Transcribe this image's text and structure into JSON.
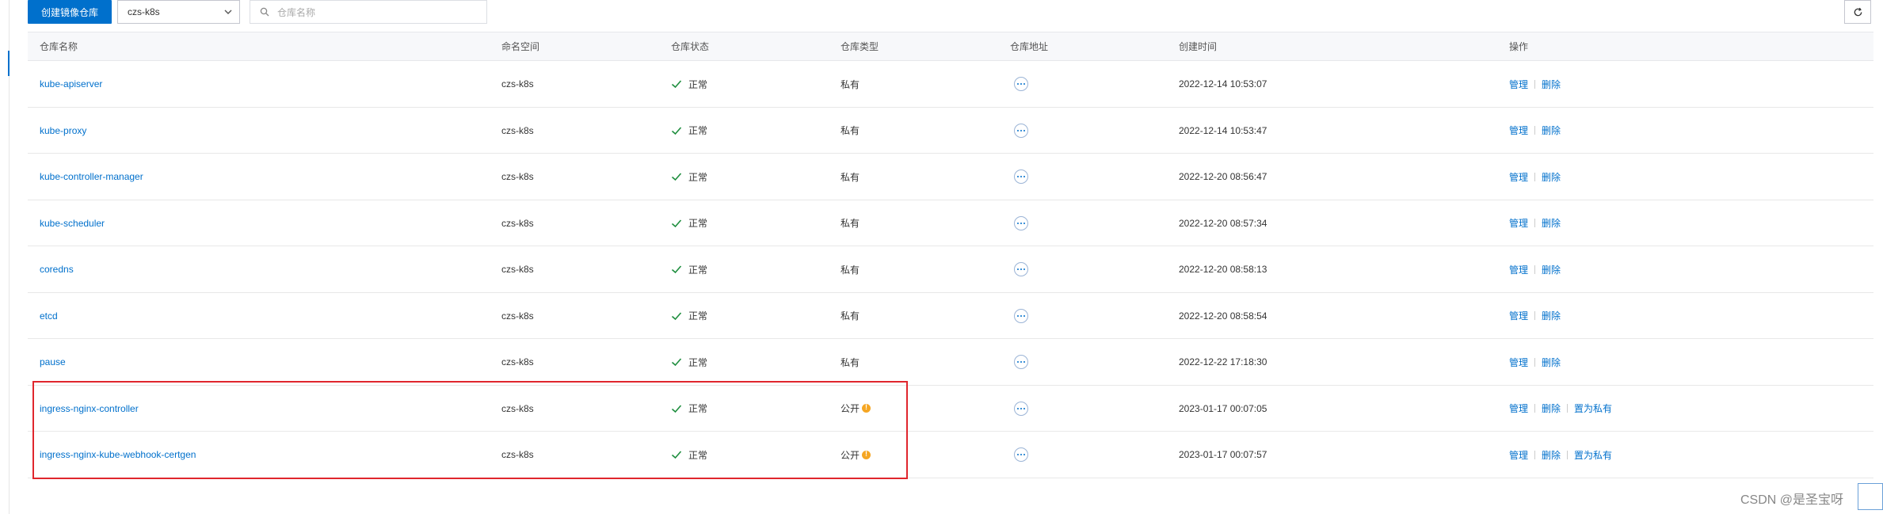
{
  "toolbar": {
    "create_label": "创建镜像仓库",
    "namespace_value": "czs-k8s",
    "search_placeholder": "仓库名称"
  },
  "columns": [
    "仓库名称",
    "命名空间",
    "仓库状态",
    "仓库类型",
    "仓库地址",
    "创建时间",
    "操作"
  ],
  "rows": [
    {
      "name": "kube-apiserver",
      "namespace": "czs-k8s",
      "status": "正常",
      "type": "私有",
      "created": "2022-12-14 10:53:07",
      "ops": [
        "管理",
        "删除"
      ]
    },
    {
      "name": "kube-proxy",
      "namespace": "czs-k8s",
      "status": "正常",
      "type": "私有",
      "created": "2022-12-14 10:53:47",
      "ops": [
        "管理",
        "删除"
      ]
    },
    {
      "name": "kube-controller-manager",
      "namespace": "czs-k8s",
      "status": "正常",
      "type": "私有",
      "created": "2022-12-20 08:56:47",
      "ops": [
        "管理",
        "删除"
      ]
    },
    {
      "name": "kube-scheduler",
      "namespace": "czs-k8s",
      "status": "正常",
      "type": "私有",
      "created": "2022-12-20 08:57:34",
      "ops": [
        "管理",
        "删除"
      ]
    },
    {
      "name": "coredns",
      "namespace": "czs-k8s",
      "status": "正常",
      "type": "私有",
      "created": "2022-12-20 08:58:13",
      "ops": [
        "管理",
        "删除"
      ]
    },
    {
      "name": "etcd",
      "namespace": "czs-k8s",
      "status": "正常",
      "type": "私有",
      "created": "2022-12-20 08:58:54",
      "ops": [
        "管理",
        "删除"
      ]
    },
    {
      "name": "pause",
      "namespace": "czs-k8s",
      "status": "正常",
      "type": "私有",
      "created": "2022-12-22 17:18:30",
      "ops": [
        "管理",
        "删除"
      ]
    },
    {
      "name": "ingress-nginx-controller",
      "namespace": "czs-k8s",
      "status": "正常",
      "type": "公开",
      "created": "2023-01-17 00:07:05",
      "ops": [
        "管理",
        "删除",
        "置为私有"
      ]
    },
    {
      "name": "ingress-nginx-kube-webhook-certgen",
      "namespace": "czs-k8s",
      "status": "正常",
      "type": "公开",
      "created": "2023-01-17 00:07:57",
      "ops": [
        "管理",
        "删除",
        "置为私有"
      ]
    }
  ],
  "watermark": "CSDN @是圣宝呀",
  "colors": {
    "accent": "#0070cc",
    "success": "#1e8e3e",
    "warning": "#f5a623",
    "highlight": "#e0262d"
  },
  "icons": {
    "search": "search-icon",
    "refresh": "refresh-icon",
    "more": "more-icon",
    "status": "check-icon"
  }
}
